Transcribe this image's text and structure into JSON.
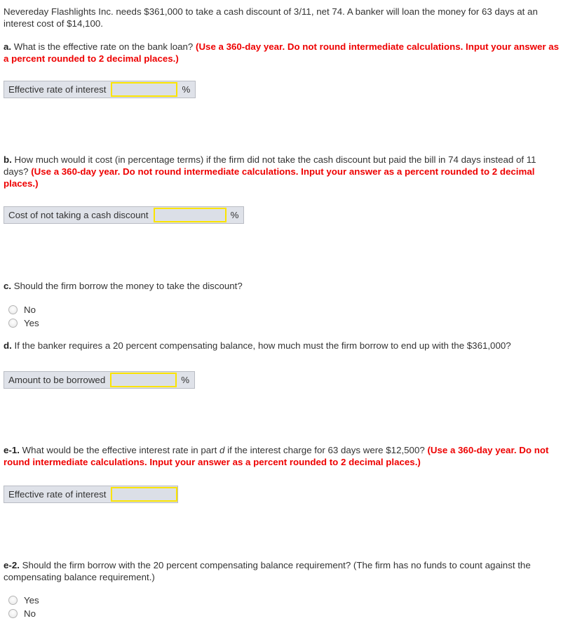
{
  "colors": {
    "body_text": "#333333",
    "emphasis_red": "#ee0000",
    "answer_box_bg": "#dfe2e9",
    "answer_box_border": "#b9bcc4",
    "input_border_yellow": "#fbe400",
    "input_bg": "#dbdfe7",
    "page_bg": "#ffffff"
  },
  "intro": {
    "text": "Nevereday Flashlights Inc. needs $361,000 to take a cash discount of 3/11, net 74. A banker will loan the money for 63 days at an interest cost of $14,100."
  },
  "parts": {
    "a": {
      "label": "a.",
      "question": "What is the effective rate on the bank loan?",
      "instruction": "(Use a 360-day year. Do not round intermediate calculations. Input your answer as a percent rounded to 2 decimal places.)",
      "answer": {
        "label": "Effective rate of interest",
        "value": "",
        "placeholder": "",
        "suffix": "%"
      }
    },
    "b": {
      "label": "b.",
      "question": "How much would it cost (in percentage terms) if the firm did not take the cash discount but paid the bill in 74 days instead of 11 days?",
      "instruction": "(Use a 360-day year. Do not round intermediate calculations. Input your answer as a percent rounded to 2 decimal places.)",
      "answer": {
        "label": "Cost of not taking a cash discount",
        "value": "",
        "placeholder": "",
        "suffix": "%"
      }
    },
    "c": {
      "label": "c.",
      "question": "Should the firm borrow the money to take the discount?",
      "options": [
        {
          "label": "No",
          "selected": false
        },
        {
          "label": "Yes",
          "selected": false
        }
      ]
    },
    "d": {
      "label": "d.",
      "question": "If the banker requires a 20 percent compensating balance, how much must the firm borrow to end up with the $361,000?",
      "answer": {
        "label": "Amount to be borrowed",
        "value": "",
        "placeholder": "",
        "suffix": "%"
      }
    },
    "e1": {
      "label": "e-1.",
      "question_part1": "What would be the effective interest rate in part",
      "question_italic": "d",
      "question_part2": "if the interest charge for 63 days were $12,500?",
      "instruction": "(Use a 360-day year. Do not round intermediate calculations. Input your answer as a percent rounded to 2 decimal places.)",
      "answer": {
        "label": "Effective rate of interest",
        "value": "",
        "placeholder": "",
        "suffix": ""
      }
    },
    "e2": {
      "label": "e-2.",
      "question": "Should the firm borrow with the 20 percent compensating balance requirement? (The firm has no funds to count against the compensating balance requirement.)",
      "options": [
        {
          "label": "Yes",
          "selected": false
        },
        {
          "label": "No",
          "selected": false
        }
      ]
    }
  }
}
